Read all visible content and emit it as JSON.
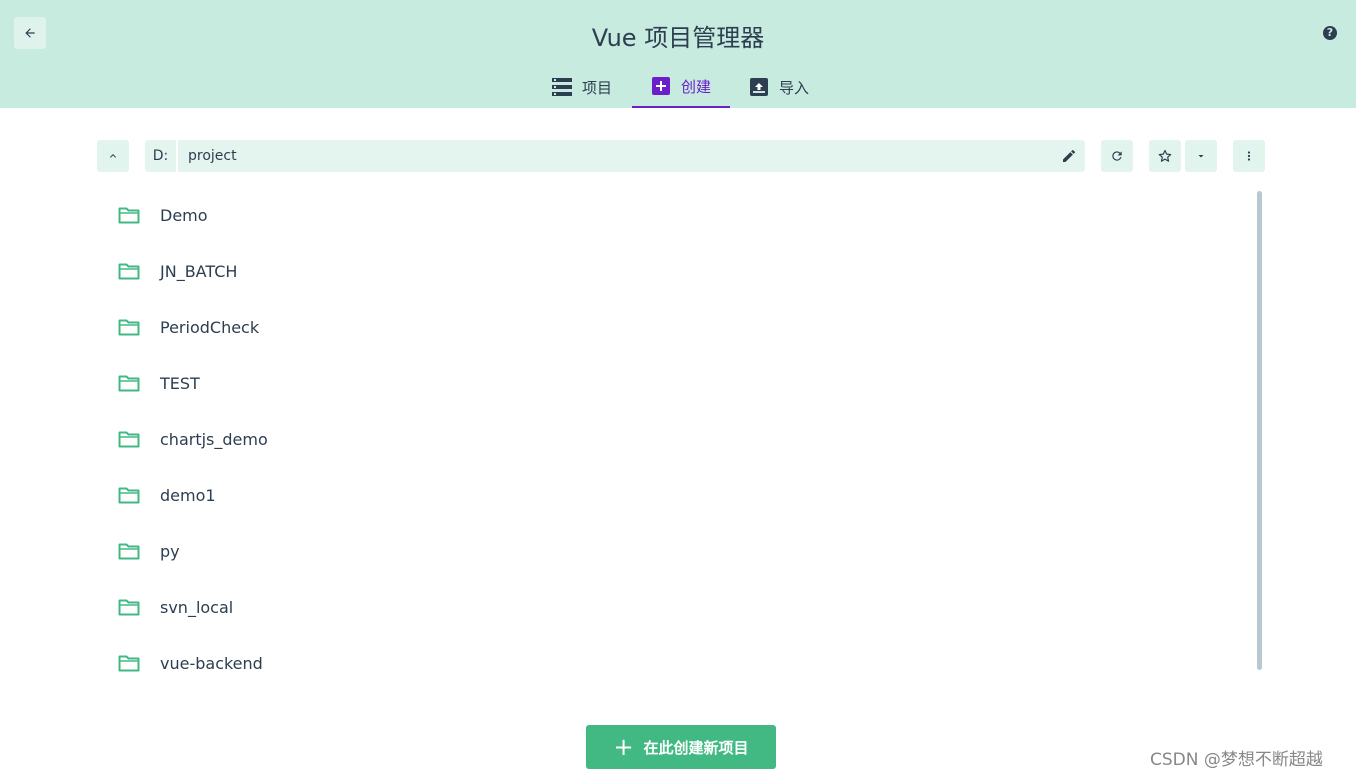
{
  "header": {
    "title": "Vue 项目管理器",
    "back_icon": "arrow-left-icon",
    "help_icon": "help-circle-icon",
    "help_glyph": "?"
  },
  "tabs": [
    {
      "label": "项目",
      "icon": "list-icon",
      "active": false
    },
    {
      "label": "创建",
      "icon": "add-box-icon",
      "active": true
    },
    {
      "label": "导入",
      "icon": "unarchive-icon",
      "active": false
    }
  ],
  "toolbar": {
    "drive": "D:",
    "path": "project"
  },
  "folders": [
    "Demo",
    "JN_BATCH",
    "PeriodCheck",
    "TEST",
    "chartjs_demo",
    "demo1",
    "py",
    "svn_local",
    "vue-backend"
  ],
  "create_button": {
    "plus": "+",
    "label": "在此创建新项目"
  },
  "watermark": "CSDN @梦想不断超越",
  "colors": {
    "header_bg": "#c8ebe0",
    "accent_green": "#42b983",
    "active_tab": "#6a1fc9",
    "text": "#2c3e50"
  }
}
